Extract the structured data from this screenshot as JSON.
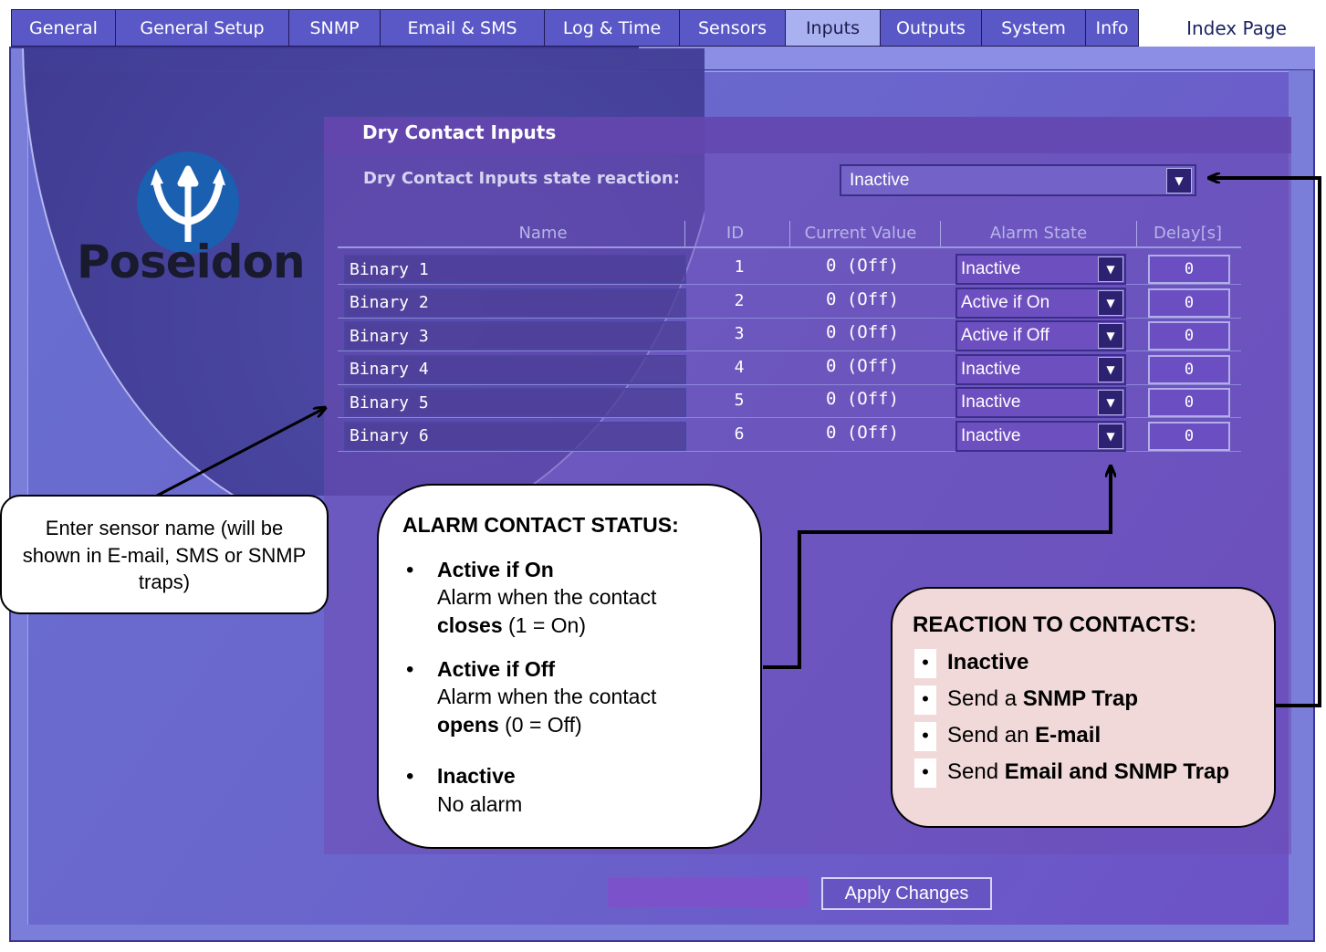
{
  "nav": {
    "tabs": [
      "General",
      "General Setup",
      "SNMP",
      "Email & SMS",
      "Log & Time",
      "Sensors",
      "Inputs",
      "Outputs",
      "System",
      "Info"
    ],
    "active_tab": "Inputs",
    "index_link": "Index Page"
  },
  "logo": {
    "text": "Poseidon",
    "icon": "trident-icon"
  },
  "panel": {
    "title": "Dry Contact Inputs",
    "reaction_label": "Dry Contact Inputs state reaction:",
    "reaction_value": "Inactive"
  },
  "table": {
    "headers": [
      "Name",
      "ID",
      "Current Value",
      "Alarm State",
      "Delay[s]"
    ],
    "rows": [
      {
        "name": "Binary 1",
        "id": "1",
        "value": "0 (Off)",
        "alarm": "Inactive",
        "delay": "0"
      },
      {
        "name": "Binary 2",
        "id": "2",
        "value": "0 (Off)",
        "alarm": "Active if On",
        "delay": "0"
      },
      {
        "name": "Binary 3",
        "id": "3",
        "value": "0 (Off)",
        "alarm": "Active if Off",
        "delay": "0"
      },
      {
        "name": "Binary 4",
        "id": "4",
        "value": "0 (Off)",
        "alarm": "Inactive",
        "delay": "0"
      },
      {
        "name": "Binary 5",
        "id": "5",
        "value": "0 (Off)",
        "alarm": "Inactive",
        "delay": "0"
      },
      {
        "name": "Binary 6",
        "id": "6",
        "value": "0 (Off)",
        "alarm": "Inactive",
        "delay": "0"
      }
    ]
  },
  "callouts": {
    "sensor_name": "Enter sensor name (will be shown in E-mail, SMS or SNMP traps)",
    "alarm_status": {
      "title": "ALARM CONTACT STATUS:",
      "items": [
        {
          "bold": "Active if On",
          "line1": "Alarm when the contact",
          "bold2": "closes",
          "rest": " (1 = On)"
        },
        {
          "bold": "Active if Off",
          "line1": "Alarm when the contact",
          "bold2": "opens",
          "rest": " (0 = Off)"
        },
        {
          "bold": "Inactive",
          "line1": "No alarm",
          "bold2": "",
          "rest": ""
        }
      ]
    },
    "reaction": {
      "title": "REACTION TO CONTACTS:",
      "items": [
        {
          "pre": "",
          "bold": "Inactive"
        },
        {
          "pre": "Send a  ",
          "bold": "SNMP Trap"
        },
        {
          "pre": "Send an ",
          "bold": "E-mail"
        },
        {
          "pre": "Send ",
          "bold": "Email and SNMP Trap"
        }
      ]
    }
  },
  "apply_button": "Apply Changes",
  "colors": {
    "frame": "#7b7ed8",
    "tab": "#5a58c6",
    "active_tab": "#aab1f0",
    "callout_pink": "#f1d9d9"
  }
}
